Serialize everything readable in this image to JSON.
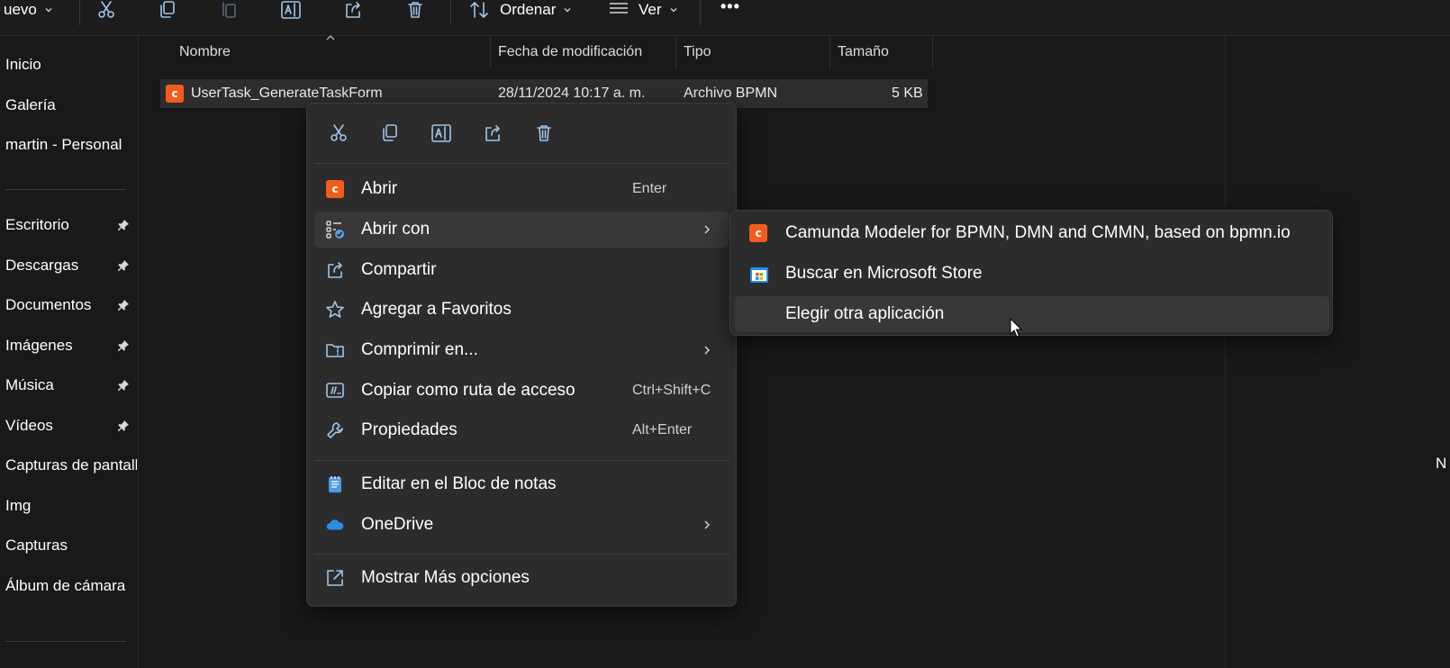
{
  "toolbar": {
    "new_label": "uevo",
    "sort_label": "Ordenar",
    "view_label": "Ver",
    "more_label": "•••"
  },
  "sidebar": {
    "items": [
      {
        "label": "Inicio"
      },
      {
        "label": "Galería"
      },
      {
        "label": "martin - Personal"
      },
      {
        "label": "Escritorio"
      },
      {
        "label": "Descargas"
      },
      {
        "label": "Documentos"
      },
      {
        "label": "Imágenes"
      },
      {
        "label": "Música"
      },
      {
        "label": "Vídeos"
      },
      {
        "label": "Capturas de pantall"
      },
      {
        "label": "Img"
      },
      {
        "label": "Capturas"
      },
      {
        "label": "Álbum de cámara"
      }
    ]
  },
  "columns": {
    "name": "Nombre",
    "modified": "Fecha de modificación",
    "type": "Tipo",
    "size": "Tamaño"
  },
  "file": {
    "name": "UserTask_GenerateTaskForm",
    "modified": "28/11/2024 10:17 a. m.",
    "type": "Archivo BPMN",
    "size": "5 KB"
  },
  "context_menu": {
    "items": [
      {
        "label": "Abrir",
        "shortcut": "Enter"
      },
      {
        "label": "Abrir con"
      },
      {
        "label": "Compartir"
      },
      {
        "label": "Agregar a Favoritos"
      },
      {
        "label": "Comprimir en..."
      },
      {
        "label": "Copiar como ruta de acceso",
        "shortcut": "Ctrl+Shift+C"
      },
      {
        "label": "Propiedades",
        "shortcut": "Alt+Enter"
      },
      {
        "label": "Editar en el Bloc de notas"
      },
      {
        "label": "OneDrive"
      },
      {
        "label": "Mostrar Más opciones"
      }
    ]
  },
  "submenu": {
    "items": [
      {
        "label": "Camunda Modeler for BPMN, DMN and CMMN, based on bpmn.io"
      },
      {
        "label": "Buscar en Microsoft Store"
      },
      {
        "label": "Elegir otra aplicación"
      }
    ]
  },
  "details_pane": {
    "edge_text": "N"
  },
  "colors": {
    "background": "#191919",
    "menu_bg": "#2c2c2c",
    "hover_bg": "#383838",
    "icon_accent": "#9ec5ea",
    "camunda_orange": "#f25d1e",
    "onedrive_blue": "#2b8ce6"
  }
}
